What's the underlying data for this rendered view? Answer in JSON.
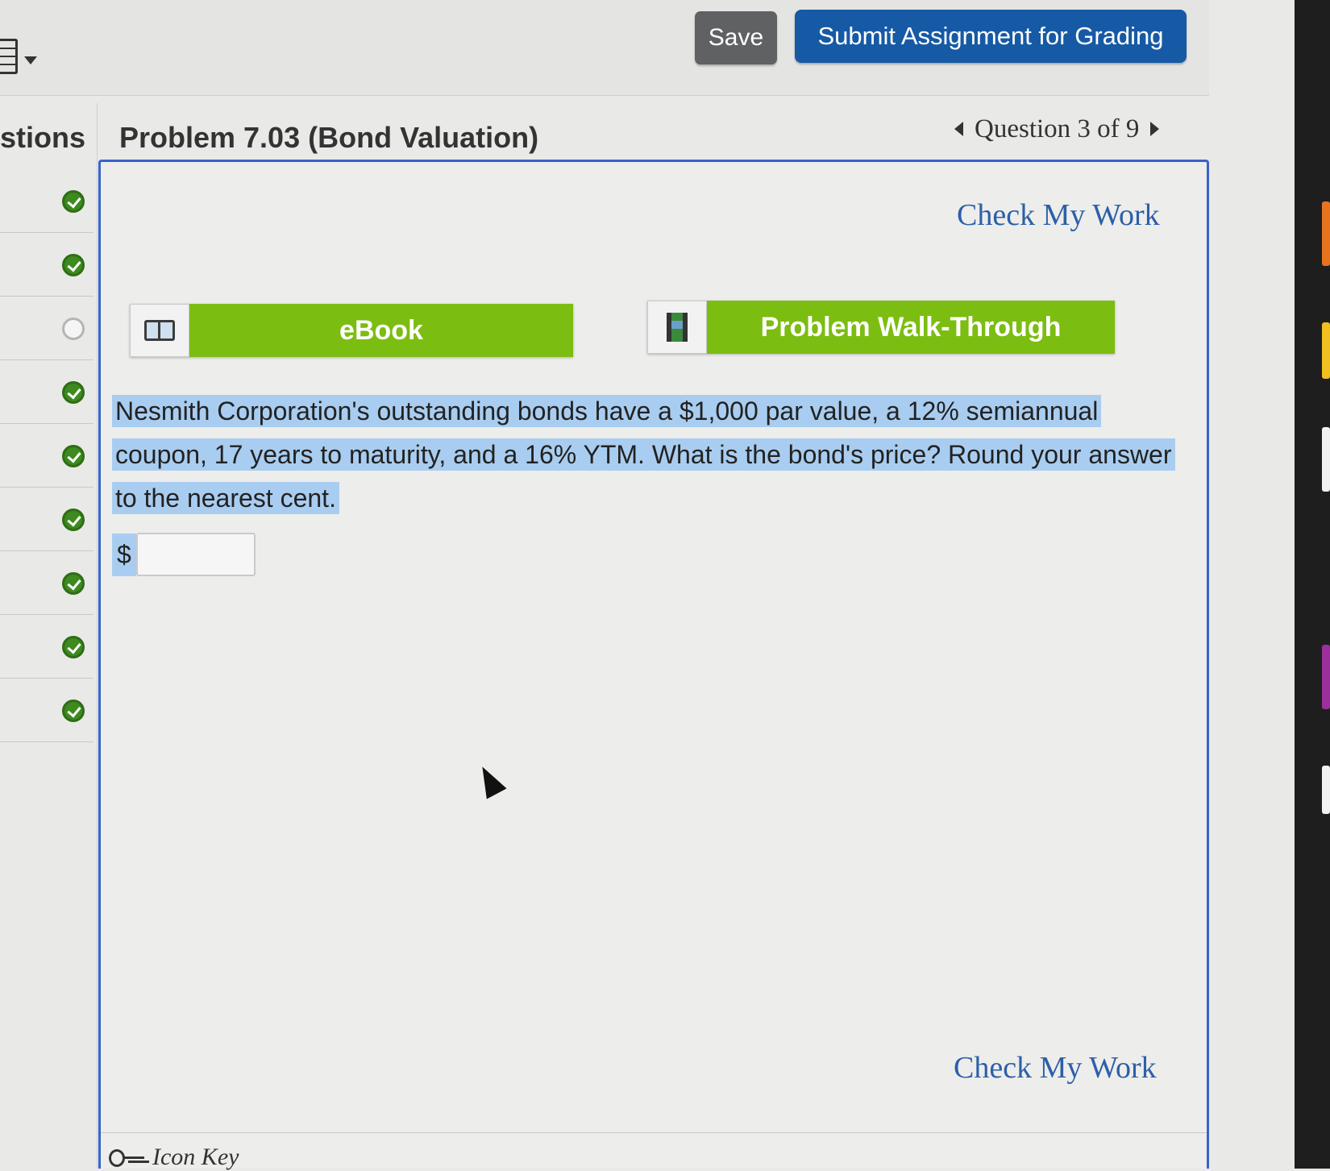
{
  "toolbar": {
    "save_label": "Save",
    "submit_label": "Submit Assignment for Grading"
  },
  "sidebar": {
    "title": "stions",
    "items": [
      {
        "status": "answered"
      },
      {
        "status": "answered"
      },
      {
        "status": "unanswered"
      },
      {
        "status": "answered"
      },
      {
        "status": "answered"
      },
      {
        "status": "answered"
      },
      {
        "status": "answered"
      },
      {
        "status": "answered"
      },
      {
        "status": "answered"
      }
    ]
  },
  "problem": {
    "title": "Problem 7.03 (Bond Valuation)",
    "nav_label": "Question 3 of 9",
    "check_my_work_top": "Check My Work",
    "check_my_work_bottom": "Check My Work",
    "ebook_label": "eBook",
    "walkthrough_label": "Problem Walk-Through",
    "question_text": "Nesmith Corporation's outstanding bonds have a $1,000 par value, a 12% semiannual coupon, 17 years to maturity, and a 16% YTM. What is the bond's price? Round your answer to the nearest cent.",
    "currency_symbol": "$",
    "answer_value": "",
    "icon_key_label": "Icon Key"
  },
  "colors": {
    "submit_blue": "#165aa5",
    "resource_green": "#7cbd11",
    "link_blue": "#2c5fa8",
    "highlight": "#a9cdf0",
    "answered_green": "#3d8a1f"
  }
}
